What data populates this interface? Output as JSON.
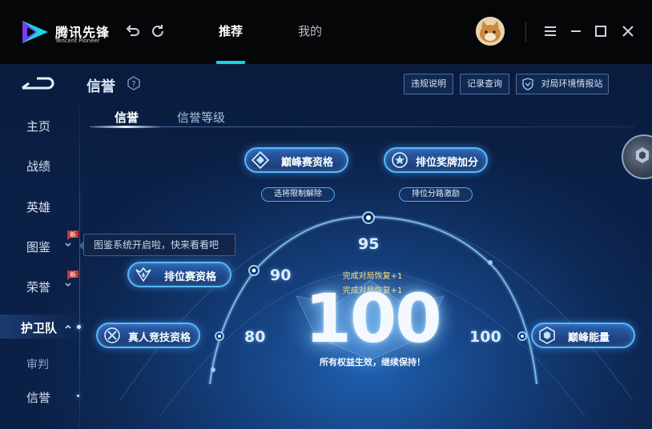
{
  "app": {
    "logo_cn": "腾讯先锋",
    "logo_en": "Tencent Pioneer"
  },
  "nav": {
    "tabs": [
      {
        "label": "推荐",
        "active": true
      },
      {
        "label": "我的",
        "active": false
      }
    ]
  },
  "colors": {
    "accent": "#16d2e6",
    "pill_border": "#58b8ff",
    "recover_text": "#ffe37a",
    "new_badge": "#c8362d"
  },
  "page": {
    "title": "信誉",
    "buttons": {
      "violation": "违规说明",
      "records": "记录查询",
      "report": "对局环境情报站"
    },
    "sub_tabs": [
      {
        "label": "信誉",
        "active": true
      },
      {
        "label": "信誉等级",
        "active": false
      }
    ]
  },
  "sidebar": {
    "items": [
      {
        "label": "主页"
      },
      {
        "label": "战绩"
      },
      {
        "label": "英雄"
      },
      {
        "label": "图鉴",
        "badge": "新"
      },
      {
        "label": "荣誉",
        "badge": "新"
      },
      {
        "label": "护卫队",
        "active": true
      },
      {
        "label": "审判"
      },
      {
        "label": "信誉"
      }
    ],
    "tooltip": "图鉴系统开启啦，快来看看吧"
  },
  "credit": {
    "score": "100",
    "recover_1": "完成对局恢复+1",
    "recover_2": "完成对局恢复+1",
    "status": "所有权益生效，继续保持！",
    "tiers": [
      "80",
      "90",
      "95",
      "100"
    ],
    "rights": {
      "peak_qual": "巅峰赛资格",
      "peak_sub": "选将限制解除",
      "rank_bonus": "排位奖牌加分",
      "rank_bonus_sub": "排位分路激励",
      "rank_qual": "排位赛资格",
      "real_person": "真人竞技资格",
      "peak_energy": "巅峰能量"
    }
  }
}
